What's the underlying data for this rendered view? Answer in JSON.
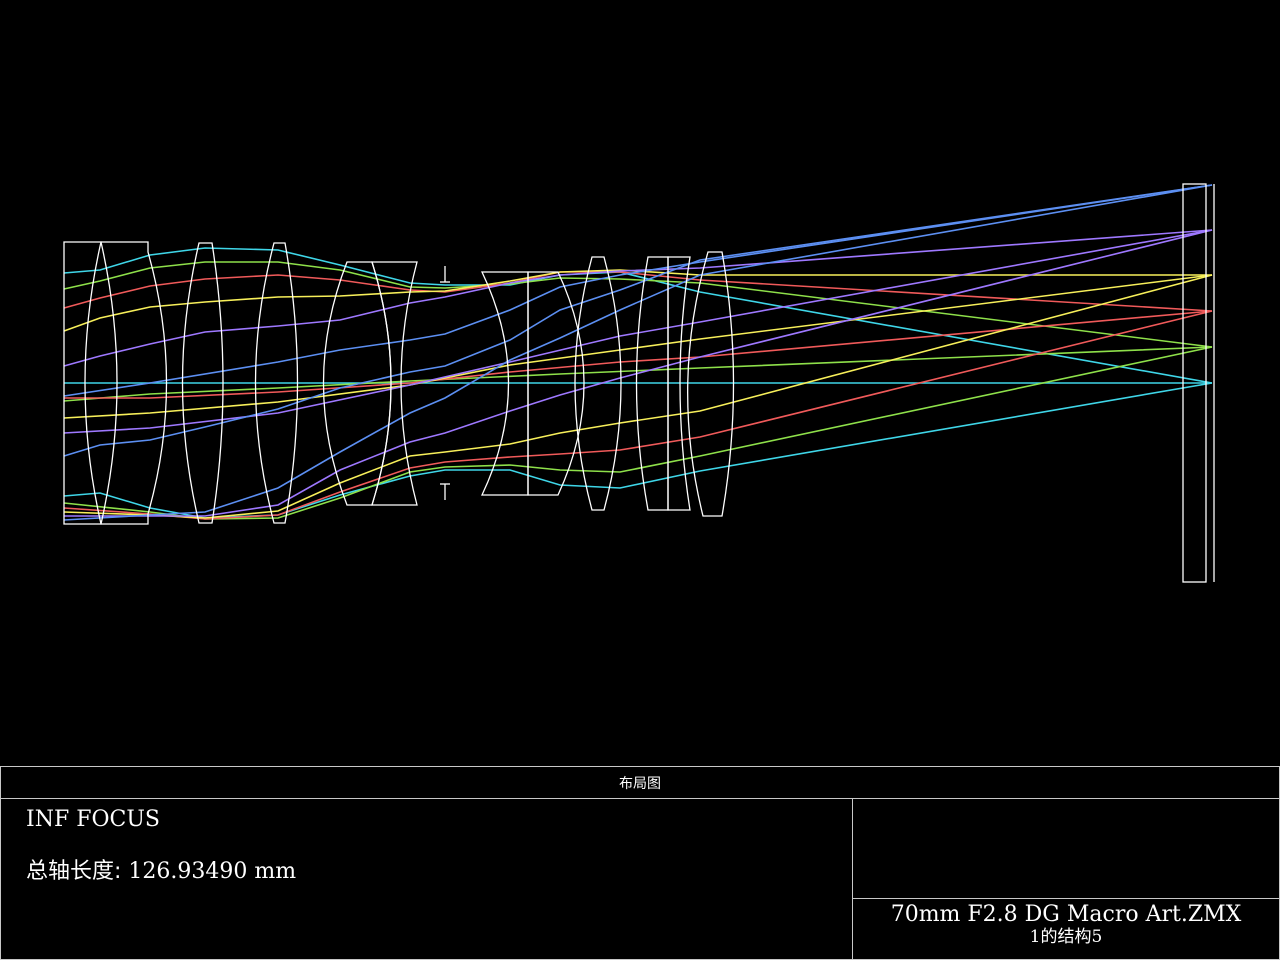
{
  "diagram": {
    "type": "optical-layout",
    "colors": {
      "background": "#000000",
      "lens_outline": "#ffffff",
      "field_1": "#3fd6e8",
      "field_2": "#8ee04a",
      "field_3": "#f05a5a",
      "field_4": "#f7ef5a",
      "field_5": "#9e78ff",
      "field_6": "#5c8ff2"
    }
  },
  "title_block": {
    "header": "布局图",
    "note_1": "INF FOCUS",
    "total_length_label": "总轴长度:",
    "total_length_value": "126.93490 mm",
    "filename": "70mm F2.8 DG Macro Art.ZMX",
    "configuration": "1的结构5"
  }
}
